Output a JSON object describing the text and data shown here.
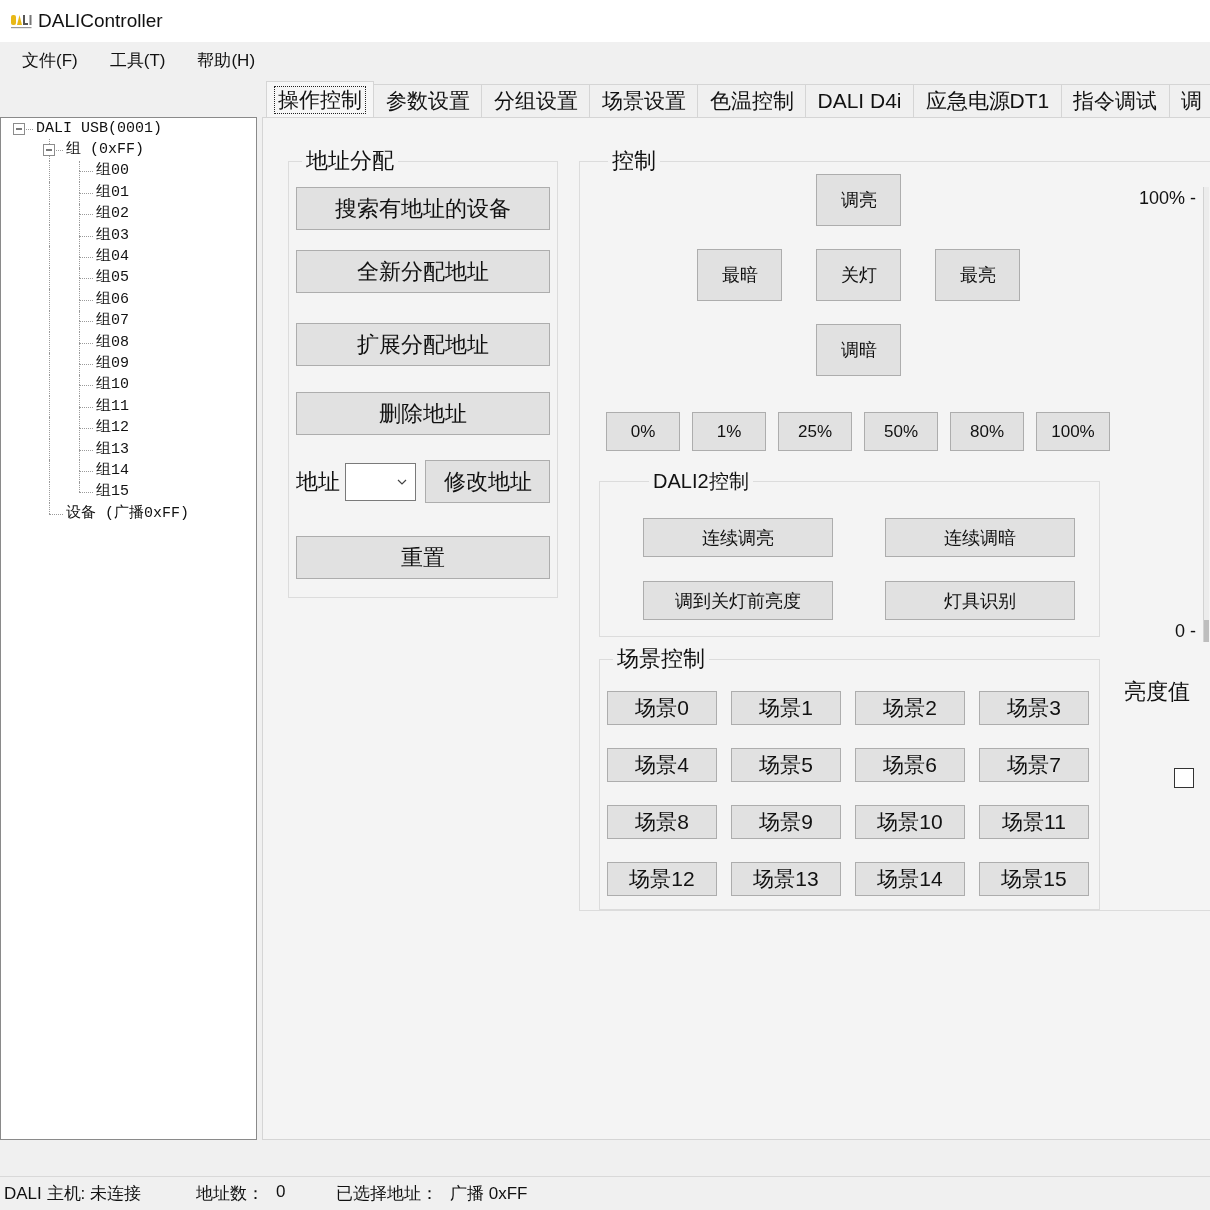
{
  "window": {
    "title": "DALIController"
  },
  "menu": [
    "文件(F)",
    "工具(T)",
    "帮助(H)"
  ],
  "tree": [
    {
      "label": "DALI USB(0001)",
      "expanded": true,
      "children": [
        {
          "label": "组 (0xFF)",
          "expanded": true,
          "children": [
            {
              "label": "组00"
            },
            {
              "label": "组01"
            },
            {
              "label": "组02"
            },
            {
              "label": "组03"
            },
            {
              "label": "组04"
            },
            {
              "label": "组05"
            },
            {
              "label": "组06"
            },
            {
              "label": "组07"
            },
            {
              "label": "组08"
            },
            {
              "label": "组09"
            },
            {
              "label": "组10"
            },
            {
              "label": "组11"
            },
            {
              "label": "组12"
            },
            {
              "label": "组13"
            },
            {
              "label": "组14"
            },
            {
              "label": "组15"
            }
          ]
        },
        {
          "label": "设备 (广播0xFF)"
        }
      ]
    }
  ],
  "tabs": [
    {
      "label": "操作控制",
      "selected": true
    },
    {
      "label": "参数设置",
      "selected": false
    },
    {
      "label": "分组设置",
      "selected": false
    },
    {
      "label": "场景设置",
      "selected": false
    },
    {
      "label": "色温控制",
      "selected": false
    },
    {
      "label": "DALI D4i",
      "selected": false
    },
    {
      "label": "应急电源DT1",
      "selected": false
    },
    {
      "label": "指令调试",
      "selected": false
    },
    {
      "label": "调",
      "selected": false
    }
  ],
  "address_group": {
    "title": "地址分配",
    "buttons": [
      "搜索有地址的设备",
      "全新分配地址",
      "扩展分配地址",
      "删除地址"
    ],
    "address_label": "地址",
    "modify_button": "修改地址",
    "reset_button": "重置"
  },
  "control_group": {
    "title": "控制",
    "pad_buttons": [
      "调亮",
      "最暗",
      "关灯",
      "最亮",
      "调暗"
    ],
    "level_buttons": [
      "0%",
      "1%",
      "25%",
      "50%",
      "80%",
      "100%"
    ],
    "dali2_group": {
      "title": "DALI2控制",
      "buttons": [
        "连续调亮",
        "连续调暗",
        "调到关灯前亮度",
        "灯具识别"
      ]
    },
    "scene_group": {
      "title": "场景控制",
      "buttons": [
        "场景0",
        "场景1",
        "场景2",
        "场景3",
        "场景4",
        "场景5",
        "场景6",
        "场景7",
        "场景8",
        "场景9",
        "场景10",
        "场景11",
        "场景12",
        "场景13",
        "场景14",
        "场景15"
      ]
    },
    "brightness": {
      "scale_max": "100% -",
      "scale_min": "0 -",
      "label": "亮度值",
      "slider": {
        "level": 0
      }
    },
    "checkbox": {
      "checked": false
    }
  },
  "status_bar": [
    {
      "label": "DALI 主机:",
      "value": "未连接"
    },
    {
      "label": "地址数：",
      "value": "0"
    },
    {
      "label": "已选择地址：",
      "value": "广播 0xFF"
    }
  ]
}
